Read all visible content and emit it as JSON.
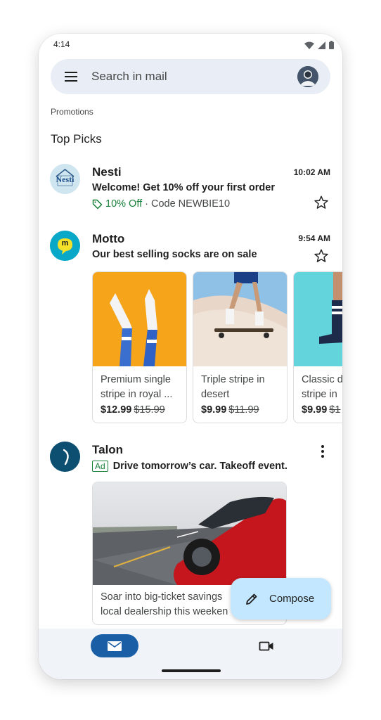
{
  "status_bar": {
    "time": "4:14",
    "icons": [
      "wifi-icon",
      "cellular-icon",
      "battery-icon"
    ]
  },
  "search": {
    "placeholder": "Search in mail",
    "menu_icon": "hamburger-menu-icon",
    "avatar_icon": "account-avatar"
  },
  "section_label": "Promotions",
  "top_picks_heading": "Top Picks",
  "emails": [
    {
      "sender": "Nesti",
      "logo_text": "Nesti",
      "time": "10:02 AM",
      "subject": "Welcome! Get 10% off your first order",
      "deal": "10% Off",
      "code": "· Code NEWBIE10",
      "starred": false
    },
    {
      "sender": "Motto",
      "logo_text": "m",
      "time": "9:54 AM",
      "subject": "Our best selling socks are on sale",
      "starred": false,
      "products": [
        {
          "name": "Premium single stripe in royal ...",
          "price": "$12.99",
          "old_price": "$15.99"
        },
        {
          "name": "Triple stripe in desert",
          "price": "$9.99",
          "old_price": "$11.99"
        },
        {
          "name": "Classic d... stripe in ...",
          "name_line1": "Classic d",
          "name_line2": "stripe in",
          "price": "$9.99",
          "old_price": "$1"
        }
      ]
    },
    {
      "sender": "Talon",
      "ad_badge": "Ad",
      "subject": "Drive tomorrow’s car. Takeoff event.",
      "ad_text_line1": "Soar into big-ticket savings",
      "ad_text_line2": "local dealership this weeken"
    }
  ],
  "compose": {
    "label": "Compose",
    "icon": "pencil-icon"
  },
  "bottom_nav": {
    "items": [
      "mail-icon",
      "video-camera-icon"
    ],
    "active": "mail"
  },
  "colors": {
    "search_bg": "#e9eef6",
    "compose_bg": "#c2e7ff",
    "deal_green": "#188038",
    "nav_active": "#1a5fa6",
    "nav_bg": "#f0f4f9"
  }
}
